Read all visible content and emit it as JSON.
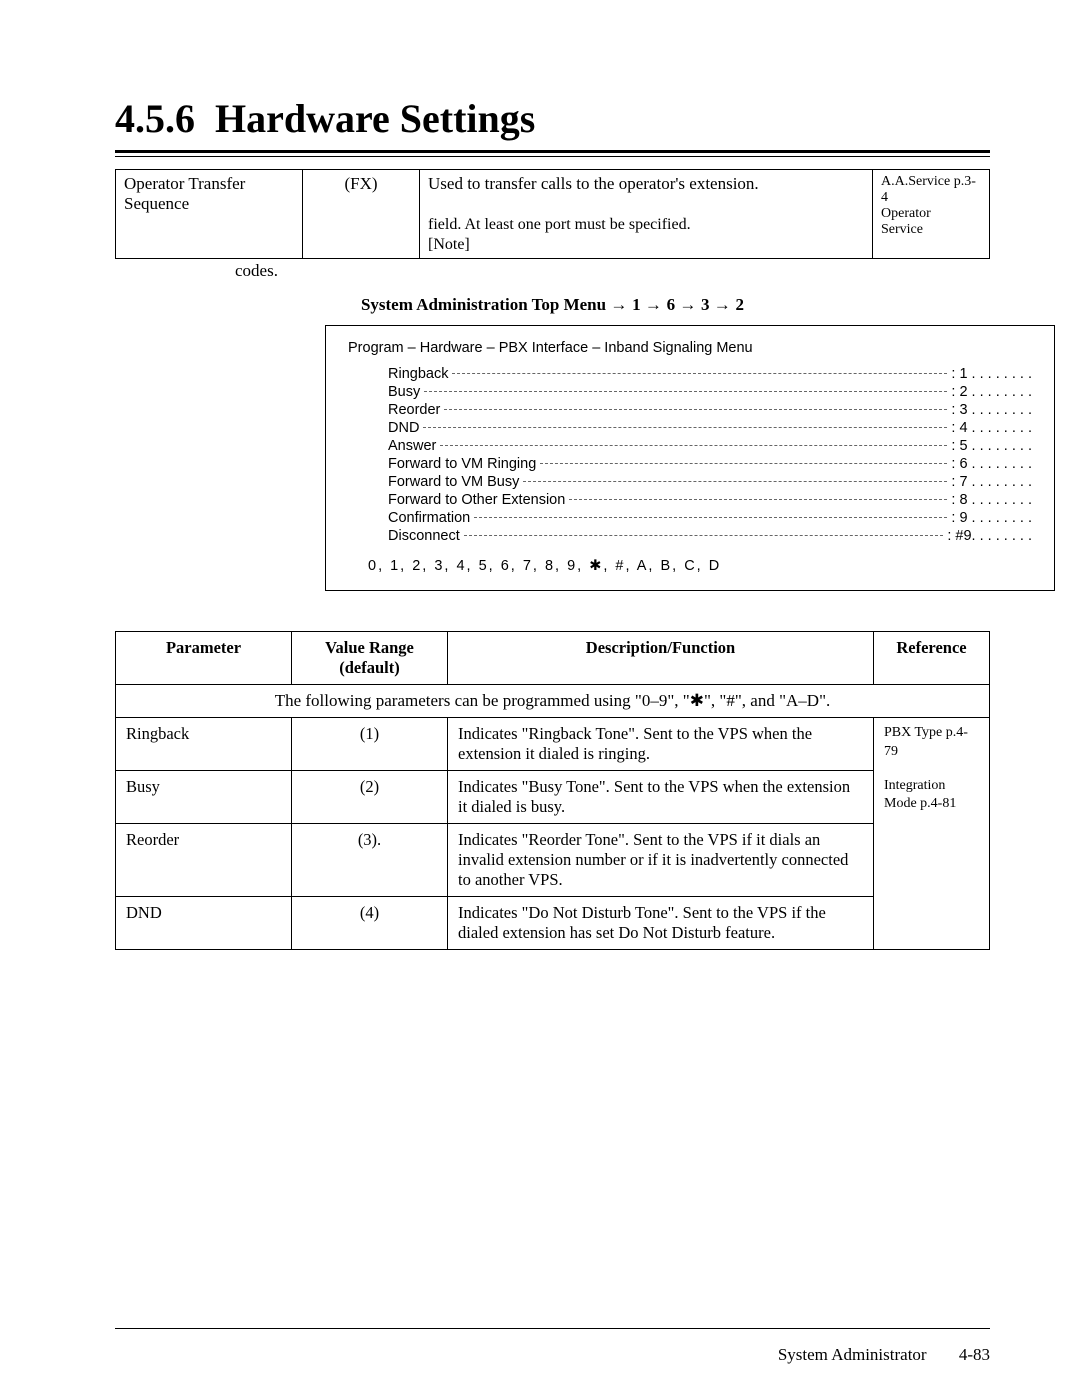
{
  "section_number": "4.5.6",
  "section_title": "Hardware Settings",
  "frag_table": {
    "c1": "Operator Transfer Sequence",
    "c2": "(FX)",
    "c3a": "Used to transfer calls to the operator's extension.",
    "c3b": "field.  At least one port must be specified.",
    "c3c": "[Note]",
    "c4a": "A.A.Service p.3-4",
    "c4b": "Operator",
    "c4c": "Service"
  },
  "codes_label": "codes.",
  "nav": {
    "prefix": "System Administration Top Menu",
    "steps": [
      "1",
      "6",
      "3",
      "2"
    ]
  },
  "menu": {
    "title": "Program – Hardware – PBX Interface – Inband Signaling Menu",
    "items": [
      {
        "label": "Ringback",
        "val": "1 . . . . . . . ."
      },
      {
        "label": "Busy",
        "val": "2 . . . . . . . ."
      },
      {
        "label": "Reorder",
        "val": "3 . . . . . . . ."
      },
      {
        "label": "DND",
        "val": "4 . . . . . . . ."
      },
      {
        "label": "Answer",
        "val": "5 . . . . . . . ."
      },
      {
        "label": "Forward to VM Ringing",
        "val": "6 . . . . . . . ."
      },
      {
        "label": "Forward to VM Busy",
        "val": "7 . . . . . . . ."
      },
      {
        "label": "Forward to Other Extension",
        "val": "8 . . . . . . . ."
      },
      {
        "label": "Confirmation",
        "val": "9 . . . . . . . ."
      },
      {
        "label": "Disconnect",
        "val": "#9. . . . . . . ."
      }
    ],
    "keys": "0,   1,   2,   3,   4,   5,   6,   7,   8,   9,   ✱,   #,   A,   B,   C,   D"
  },
  "param_header": {
    "parameter": "Parameter",
    "value": "Value Range (default)",
    "desc": "Description/Function",
    "ref": "Reference"
  },
  "param_intro": "The following parameters can be programmed using \"0–9\", \"✱\", \"#\", and \"A–D\".",
  "params": [
    {
      "name": "Ringback",
      "value": "(1)",
      "desc": "Indicates \"Ringback Tone\".  Sent to the VPS when the extension it dialed is ringing.",
      "ref": "PBX Type p.4-79"
    },
    {
      "name": "Busy",
      "value": "(2)",
      "desc": "Indicates \"Busy Tone\".  Sent to the VPS when the extension it dialed is busy.",
      "ref": "Integration Mode p.4-81"
    },
    {
      "name": "Reorder",
      "value": "(3).",
      "desc": "Indicates \"Reorder Tone\".  Sent to the VPS if it dials an invalid extension number or if it is inadvertently connected to another VPS.",
      "ref": ""
    },
    {
      "name": "DND",
      "value": "(4)",
      "desc": "Indicates \"Do Not Disturb Tone\".  Sent to the VPS if the dialed extension has set Do Not Disturb feature.",
      "ref": ""
    }
  ],
  "footer": {
    "label": "System Administrator",
    "page": "4-83"
  }
}
